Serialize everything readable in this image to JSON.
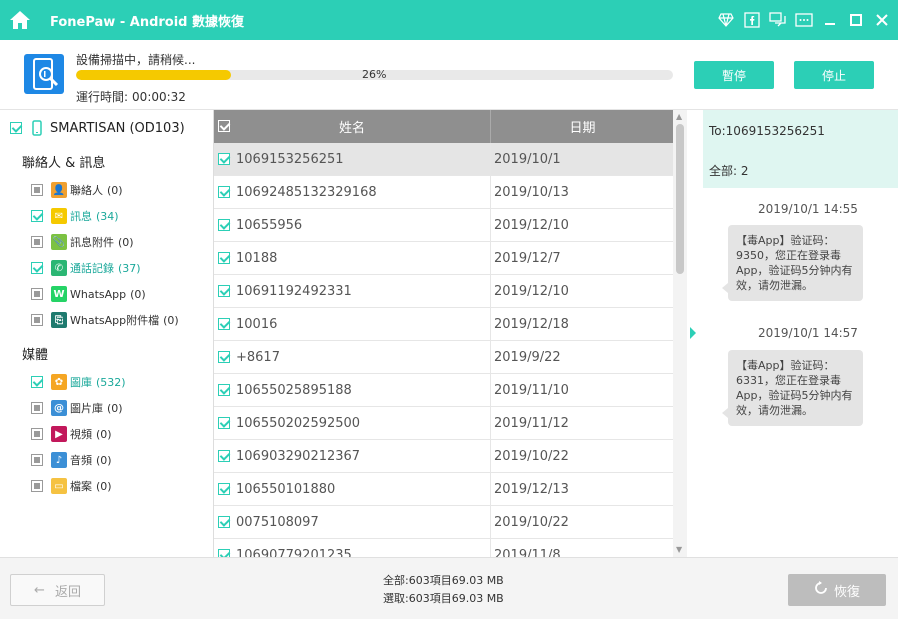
{
  "titlebar": {
    "title": "FonePaw - Android 數據恢復"
  },
  "scan": {
    "status": "設備掃描中，請稍候...",
    "progress_pct": 26,
    "progress_label": "26%",
    "runtime_label": "運行時間:",
    "runtime_value": "00:00:32",
    "pause_label": "暫停",
    "stop_label": "停止"
  },
  "sidebar": {
    "device": "SMARTISAN (OD103)",
    "contacts_section": "聯絡人 & 訊息",
    "contacts_items": [
      {
        "label": "聯絡人",
        "count": "(0)",
        "checked": false,
        "color": "#f0a030",
        "glyph": "👤"
      },
      {
        "label": "訊息",
        "count": "(34)",
        "checked": true,
        "color": "#f5c900",
        "glyph": "✉"
      },
      {
        "label": "訊息附件",
        "count": "(0)",
        "checked": false,
        "color": "#7cc242",
        "glyph": "📎"
      },
      {
        "label": "通話記錄",
        "count": "(37)",
        "checked": true,
        "color": "#2bb673",
        "glyph": "✆"
      },
      {
        "label": "WhatsApp",
        "count": "(0)",
        "checked": false,
        "color": "#25d366",
        "glyph": "W"
      },
      {
        "label": "WhatsApp附件檔",
        "count": "(0)",
        "checked": false,
        "color": "#1e7a6e",
        "glyph": "⎘"
      }
    ],
    "media_section": "媒體",
    "media_items": [
      {
        "label": "圖庫",
        "count": "(532)",
        "checked": true,
        "color": "#f5a623",
        "glyph": "✿"
      },
      {
        "label": "圖片庫",
        "count": "(0)",
        "checked": false,
        "color": "#3b8fd6",
        "glyph": "@"
      },
      {
        "label": "視頻",
        "count": "(0)",
        "checked": false,
        "color": "#c2185b",
        "glyph": "▶"
      },
      {
        "label": "音頻",
        "count": "(0)",
        "checked": false,
        "color": "#3b8fd6",
        "glyph": "♪"
      },
      {
        "label": "檔案",
        "count": "(0)",
        "checked": false,
        "color": "#f5c242",
        "glyph": "▭"
      }
    ]
  },
  "table": {
    "col_name": "姓名",
    "col_date": "日期",
    "rows": [
      {
        "name": "1069153256251",
        "date": "2019/10/1"
      },
      {
        "name": "10692485132329168",
        "date": "2019/10/13"
      },
      {
        "name": "10655956",
        "date": "2019/12/10"
      },
      {
        "name": "10188",
        "date": "2019/12/7"
      },
      {
        "name": "10691192492331",
        "date": "2019/12/10"
      },
      {
        "name": "10016",
        "date": "2019/12/18"
      },
      {
        "name": "+8617",
        "date": "2019/9/22"
      },
      {
        "name": "10655025895188",
        "date": "2019/11/10"
      },
      {
        "name": "106550202592500",
        "date": "2019/11/12"
      },
      {
        "name": "106903290212367",
        "date": "2019/10/22"
      },
      {
        "name": "106550101880",
        "date": "2019/12/13"
      },
      {
        "name": "0075108097",
        "date": "2019/10/22"
      },
      {
        "name": "10690779201235",
        "date": "2019/11/8"
      }
    ]
  },
  "messages": {
    "to": "To:1069153256251",
    "total": "全部: 2",
    "items": [
      {
        "time": "2019/10/1 14:55",
        "text": "【毒App】验证码：9350，您正在登录毒App，验证码5分钟内有效，请勿泄漏。"
      },
      {
        "time": "2019/10/1 14:57",
        "text": "【毒App】验证码：6331，您正在登录毒App，验证码5分钟内有效，请勿泄漏。"
      }
    ]
  },
  "footer": {
    "back_label": "返回",
    "total_stats": "全部:603項目69.03 MB",
    "selected_stats": "選取:603項目69.03 MB",
    "recover_label": "恢復"
  },
  "colors": {
    "accent": "#2ccfb6",
    "progress": "#f5c900"
  }
}
